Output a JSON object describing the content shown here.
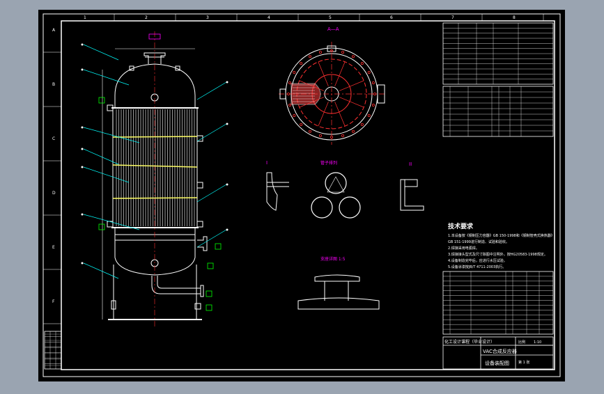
{
  "colors": {
    "viewport_bg": "#9aa4b1",
    "sheet": "#000000",
    "line": "#ffffff",
    "leader": "#00ffff",
    "label": "#ffffff",
    "accent": "#ff00ff",
    "tag": "#00ff00",
    "tag_red": "#ff2020",
    "tube_band": "#ffff66",
    "hatch": "#ff4040"
  },
  "tech_requirements": {
    "title": "技术要求",
    "items": [
      "1.本设备按《钢制压力容器》GB 150-1998和《钢制管壳式换热器》",
      "GB 151-1999进行制造、试验和验收。",
      "2.焊接采用电弧焊。",
      "3.焊接接头型式及尺寸除图中注明外，按HG20583-1998规定。",
      "4.设备制造完毕后，应进行水压试验。",
      "5.设备涂漆按JB/T 4711-2003执行。"
    ]
  },
  "title_block": {
    "drawing_name": "VAC合成反应器",
    "drawing_subtitle": "设备装配图",
    "org": "化工设计课程（毕业设计）",
    "scale_label": "比例",
    "scale": "1:10",
    "sheet_label": "第 1 张"
  },
  "section_labels": {
    "top_view": "A—A",
    "detail_left": "I",
    "detail_right": "II",
    "tube_pattern": "管子排列",
    "support": "支座详图 1:5"
  },
  "frame_marks": {
    "rows": [
      "A",
      "B",
      "C",
      "D",
      "E",
      "F"
    ],
    "cols": [
      "1",
      "2",
      "3",
      "4",
      "5",
      "6",
      "7",
      "8"
    ]
  }
}
